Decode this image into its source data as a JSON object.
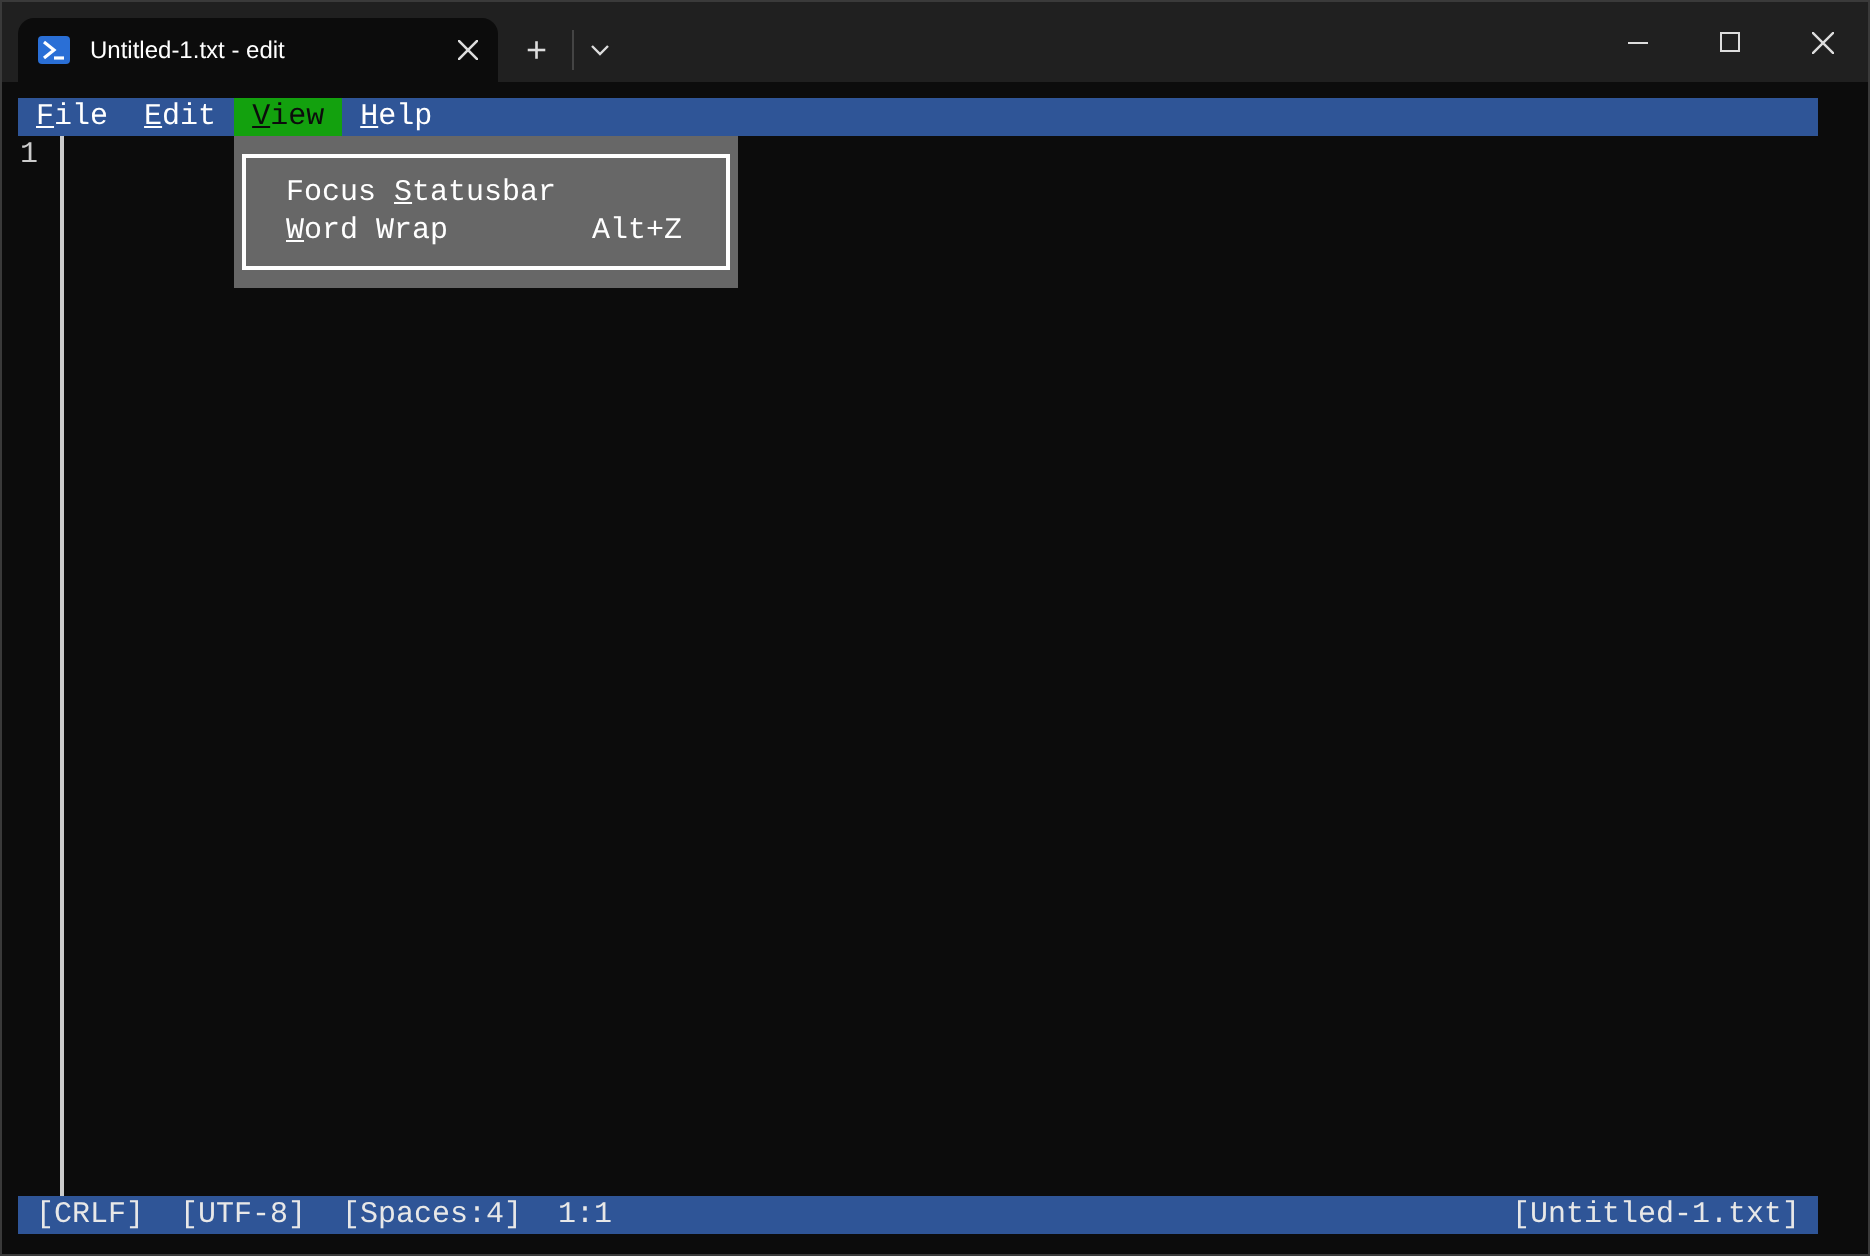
{
  "window": {
    "tab_title": "Untitled-1.txt - edit",
    "new_tab": "+"
  },
  "menu_bar": [
    {
      "key": "F",
      "after": "ile",
      "selected": false
    },
    {
      "key": "E",
      "after": "dit",
      "selected": false
    },
    {
      "key": "V",
      "after": "iew",
      "selected": true
    },
    {
      "key": "H",
      "after": "elp",
      "selected": false
    }
  ],
  "view_menu": [
    {
      "before": "Focus ",
      "key": "S",
      "after": "tatusbar"
    },
    {
      "key": "W",
      "after": "ord Wrap",
      "shortcut": "Alt+Z"
    }
  ],
  "editor": {
    "line_numbers": [
      "1"
    ]
  },
  "status_bar": {
    "left": [
      "[CRLF]",
      "[UTF-8]",
      "[Spaces:4]",
      "1:1"
    ],
    "right": "[Untitled-1.txt]"
  }
}
